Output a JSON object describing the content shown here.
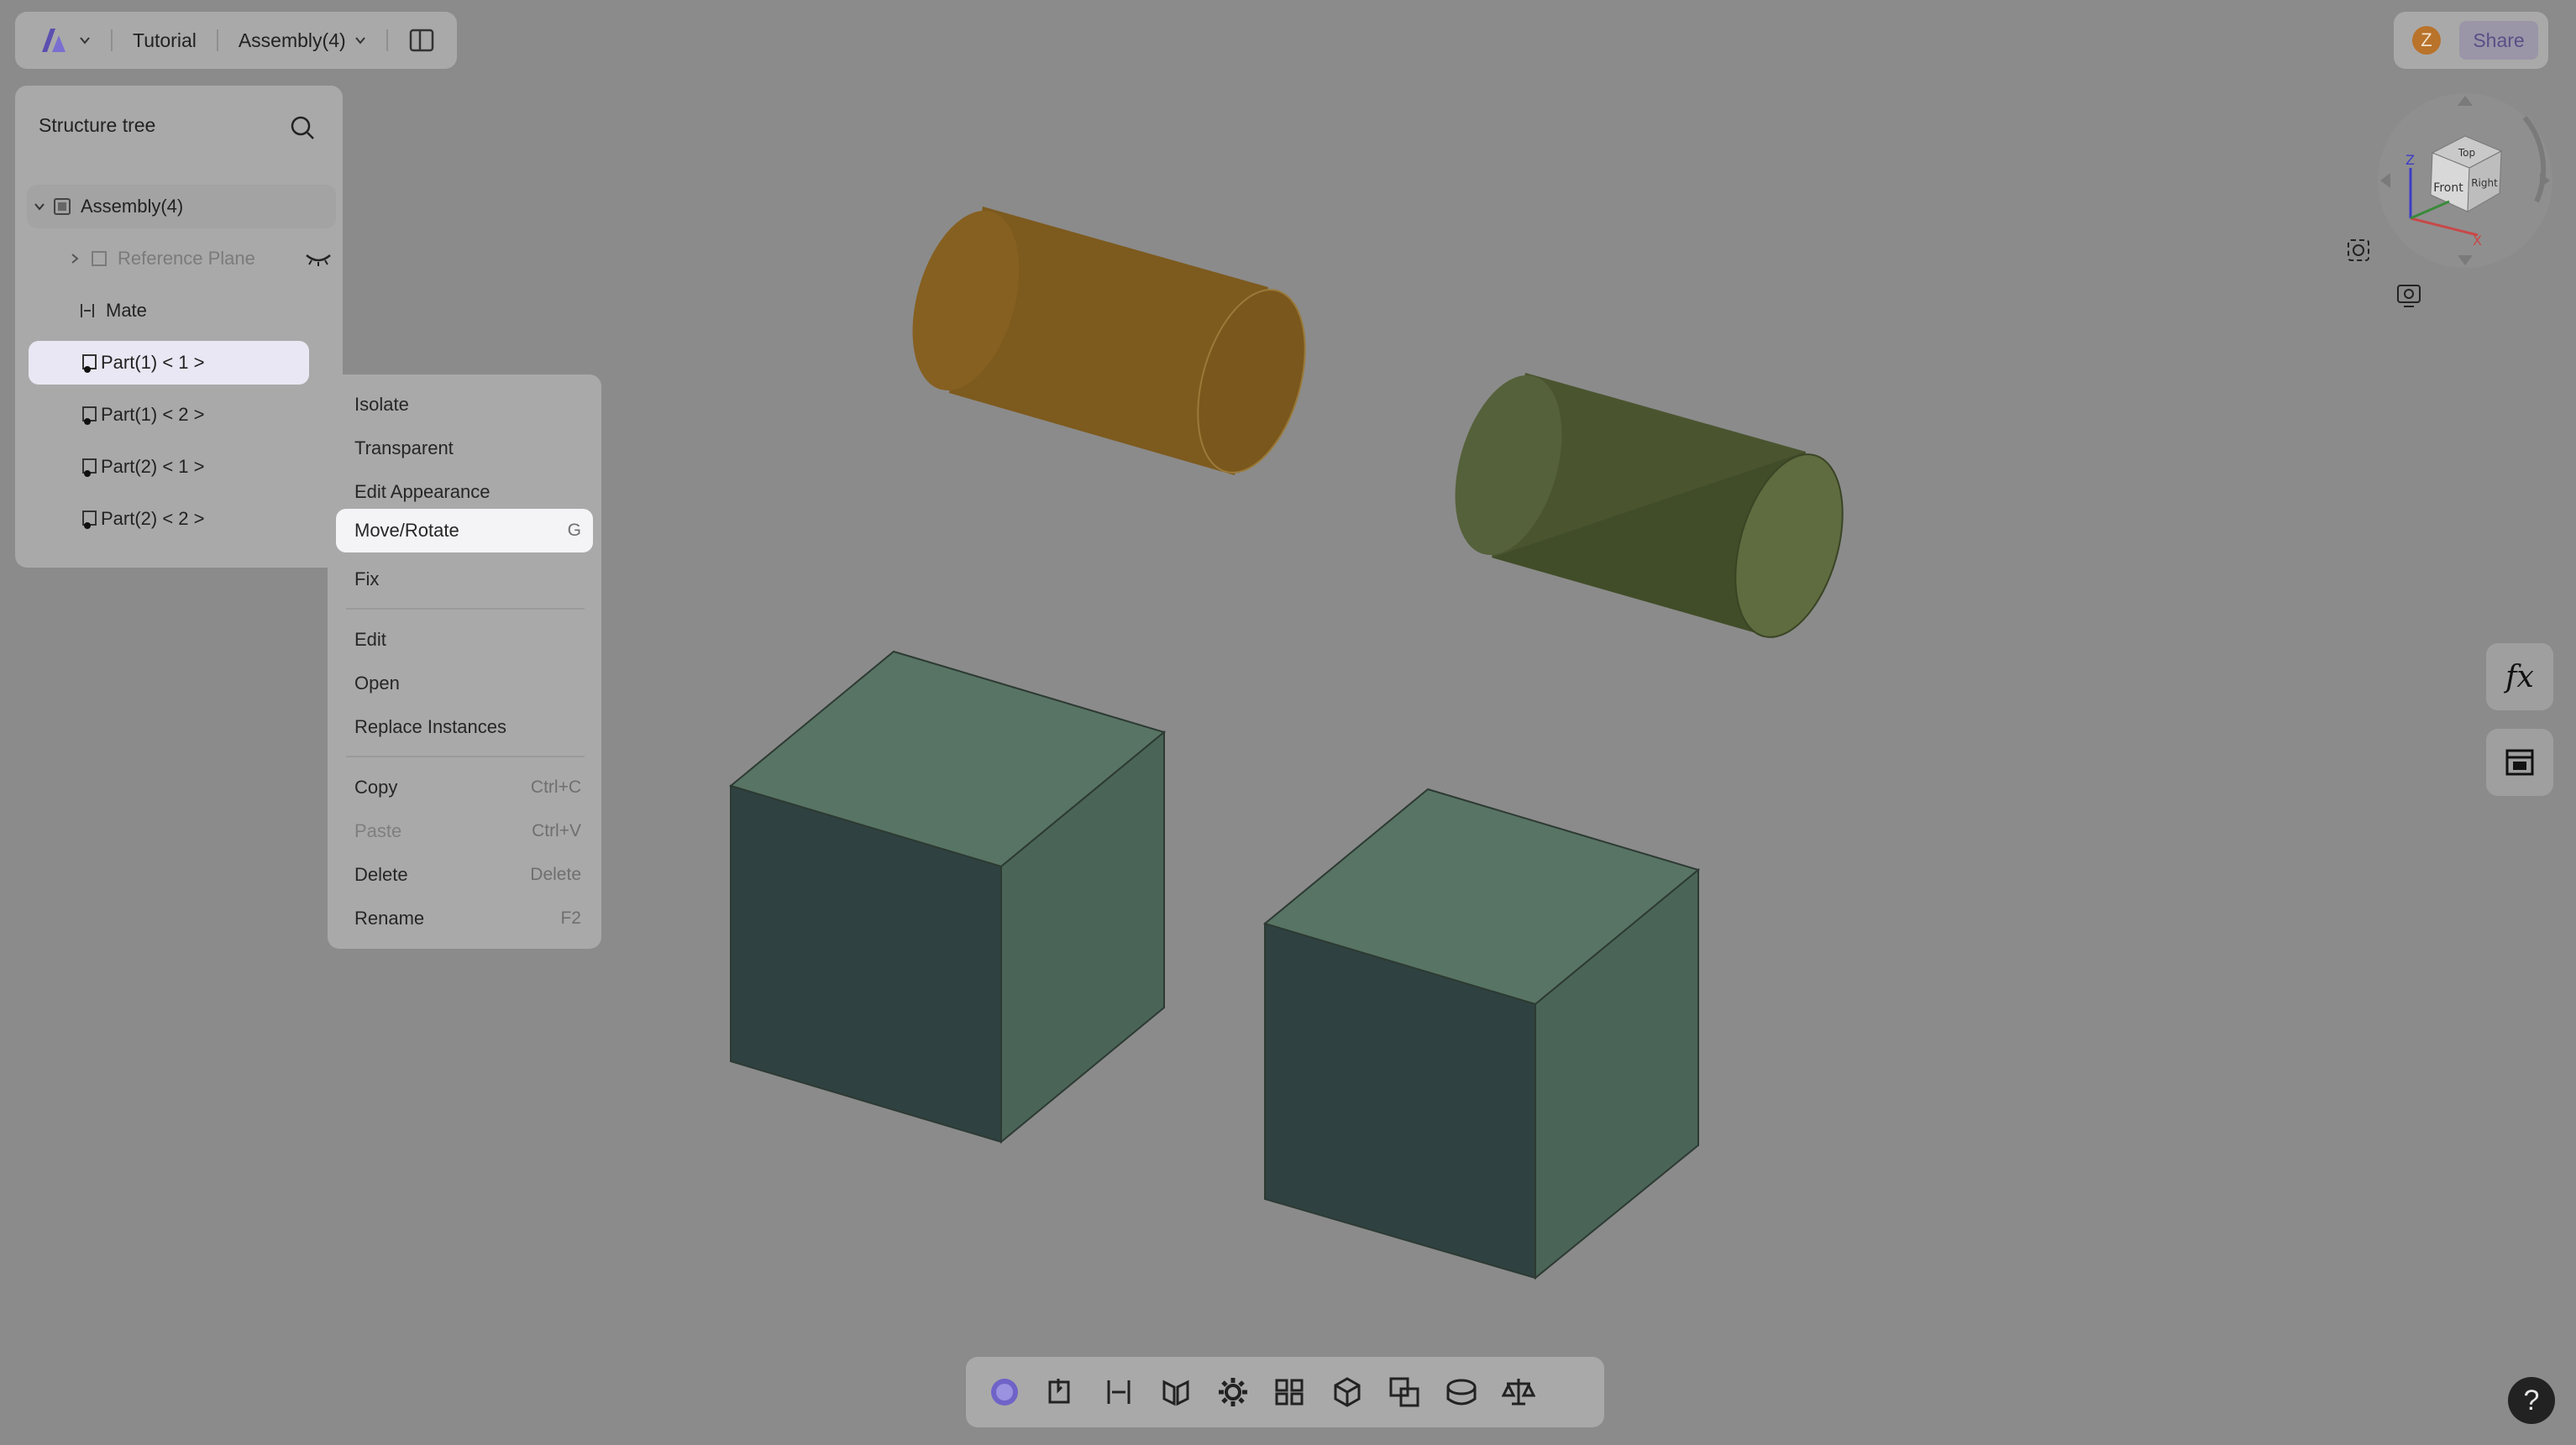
{
  "topbar": {
    "tutorial": "Tutorial",
    "assembly": "Assembly(4)"
  },
  "user": {
    "initial": "Z",
    "share": "Share"
  },
  "tree": {
    "title": "Structure tree",
    "items": [
      {
        "label": "Assembly(4)"
      },
      {
        "label": "Reference Plane"
      },
      {
        "label": "Mate"
      },
      {
        "label": "Part(1) < 1 >"
      },
      {
        "label": "Part(1) < 2 >"
      },
      {
        "label": "Part(2) < 1 >"
      },
      {
        "label": "Part(2) < 2 >"
      }
    ]
  },
  "menu": {
    "items": [
      {
        "label": "Isolate",
        "shortcut": ""
      },
      {
        "label": "Transparent",
        "shortcut": ""
      },
      {
        "label": "Edit Appearance",
        "shortcut": ""
      },
      {
        "label": "Move/Rotate",
        "shortcut": "G"
      },
      {
        "label": "Fix",
        "shortcut": ""
      },
      {
        "label": "Edit",
        "shortcut": ""
      },
      {
        "label": "Open",
        "shortcut": ""
      },
      {
        "label": "Replace Instances",
        "shortcut": ""
      },
      {
        "label": "Copy",
        "shortcut": "Ctrl+C"
      },
      {
        "label": "Paste",
        "shortcut": "Ctrl+V"
      },
      {
        "label": "Delete",
        "shortcut": "Delete"
      },
      {
        "label": "Rename",
        "shortcut": "F2"
      }
    ]
  },
  "viewcube": {
    "top": "Top",
    "front": "Front",
    "right": "Right",
    "axis_z": "Z",
    "axis_x": "X"
  },
  "side": {
    "fx": "fx"
  },
  "help": "?",
  "colors": {
    "background": "#8b8b8b",
    "cylinder_orange": "#8a6420",
    "cylinder_green": "#5d6b3d",
    "cube_face": "#5a7566"
  }
}
